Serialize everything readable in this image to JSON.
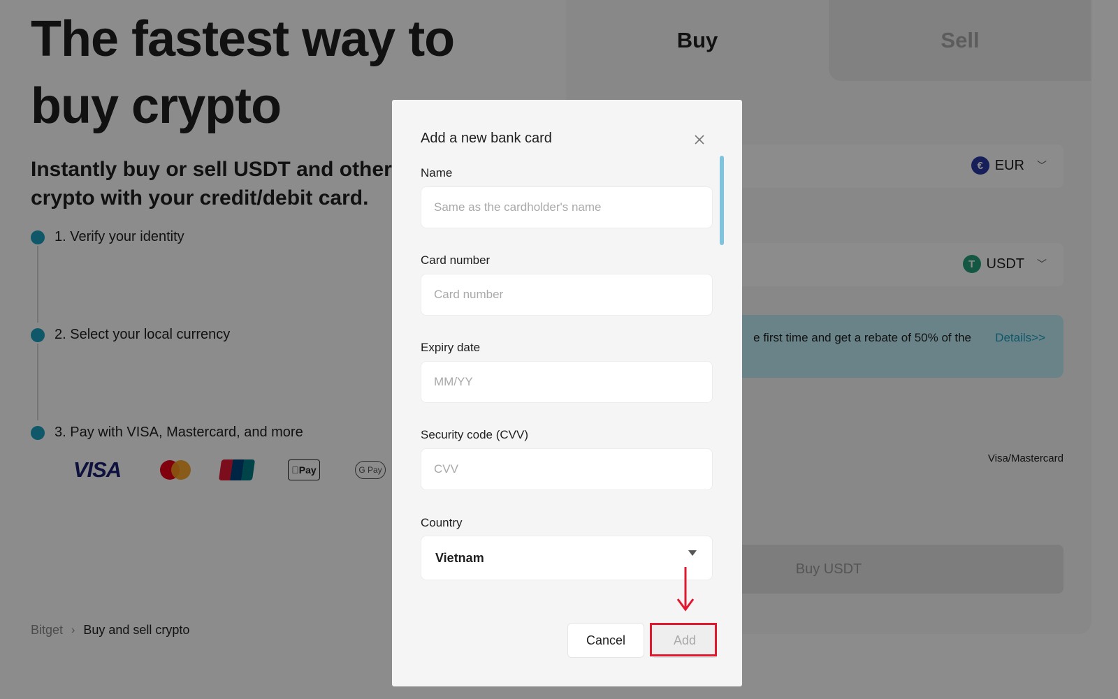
{
  "hero": {
    "title": "The fastest way to buy crypto",
    "subtitle": "Instantly buy or sell USDT and other crypto with your credit/debit card."
  },
  "steps": [
    {
      "label": "1. Verify your identity"
    },
    {
      "label": "2. Select your local currency"
    },
    {
      "label": "3. Pay with VISA, Mastercard, and more"
    }
  ],
  "payment_logos": {
    "visa": "VISA",
    "apple_pay": "Pay",
    "google_pay": "G Pay",
    "icons": [
      "visa-logo",
      "mastercard-logo",
      "unionpay-logo",
      "apple-pay-logo",
      "google-pay-logo"
    ]
  },
  "breadcrumb": {
    "root": "Bitget",
    "current": "Buy and sell crypto"
  },
  "widget": {
    "tab_buy": "Buy",
    "tab_sell": "Sell",
    "fiat_currency": "EUR",
    "crypto_currency": "USDT",
    "promo_text": "e first time and get a rebate of 50% of the",
    "promo_link": "Details>>",
    "payment_method": "Visa/Mastercard",
    "buy_button": "Buy USDT"
  },
  "modal": {
    "title": "Add a new bank card",
    "fields": {
      "name": {
        "label": "Name",
        "placeholder": "Same as the cardholder's name",
        "value": ""
      },
      "card_number": {
        "label": "Card number",
        "placeholder": "Card number",
        "value": ""
      },
      "expiry": {
        "label": "Expiry date",
        "placeholder": "MM/YY",
        "value": ""
      },
      "cvv": {
        "label": "Security code (CVV)",
        "placeholder": "CVV",
        "value": ""
      },
      "country": {
        "label": "Country",
        "value": "Vietnam"
      }
    },
    "cancel_label": "Cancel",
    "add_label": "Add"
  },
  "colors": {
    "accent": "#1ba1c2",
    "highlight": "#e0192e",
    "overlay": "rgba(0,0,0,0.45)"
  }
}
